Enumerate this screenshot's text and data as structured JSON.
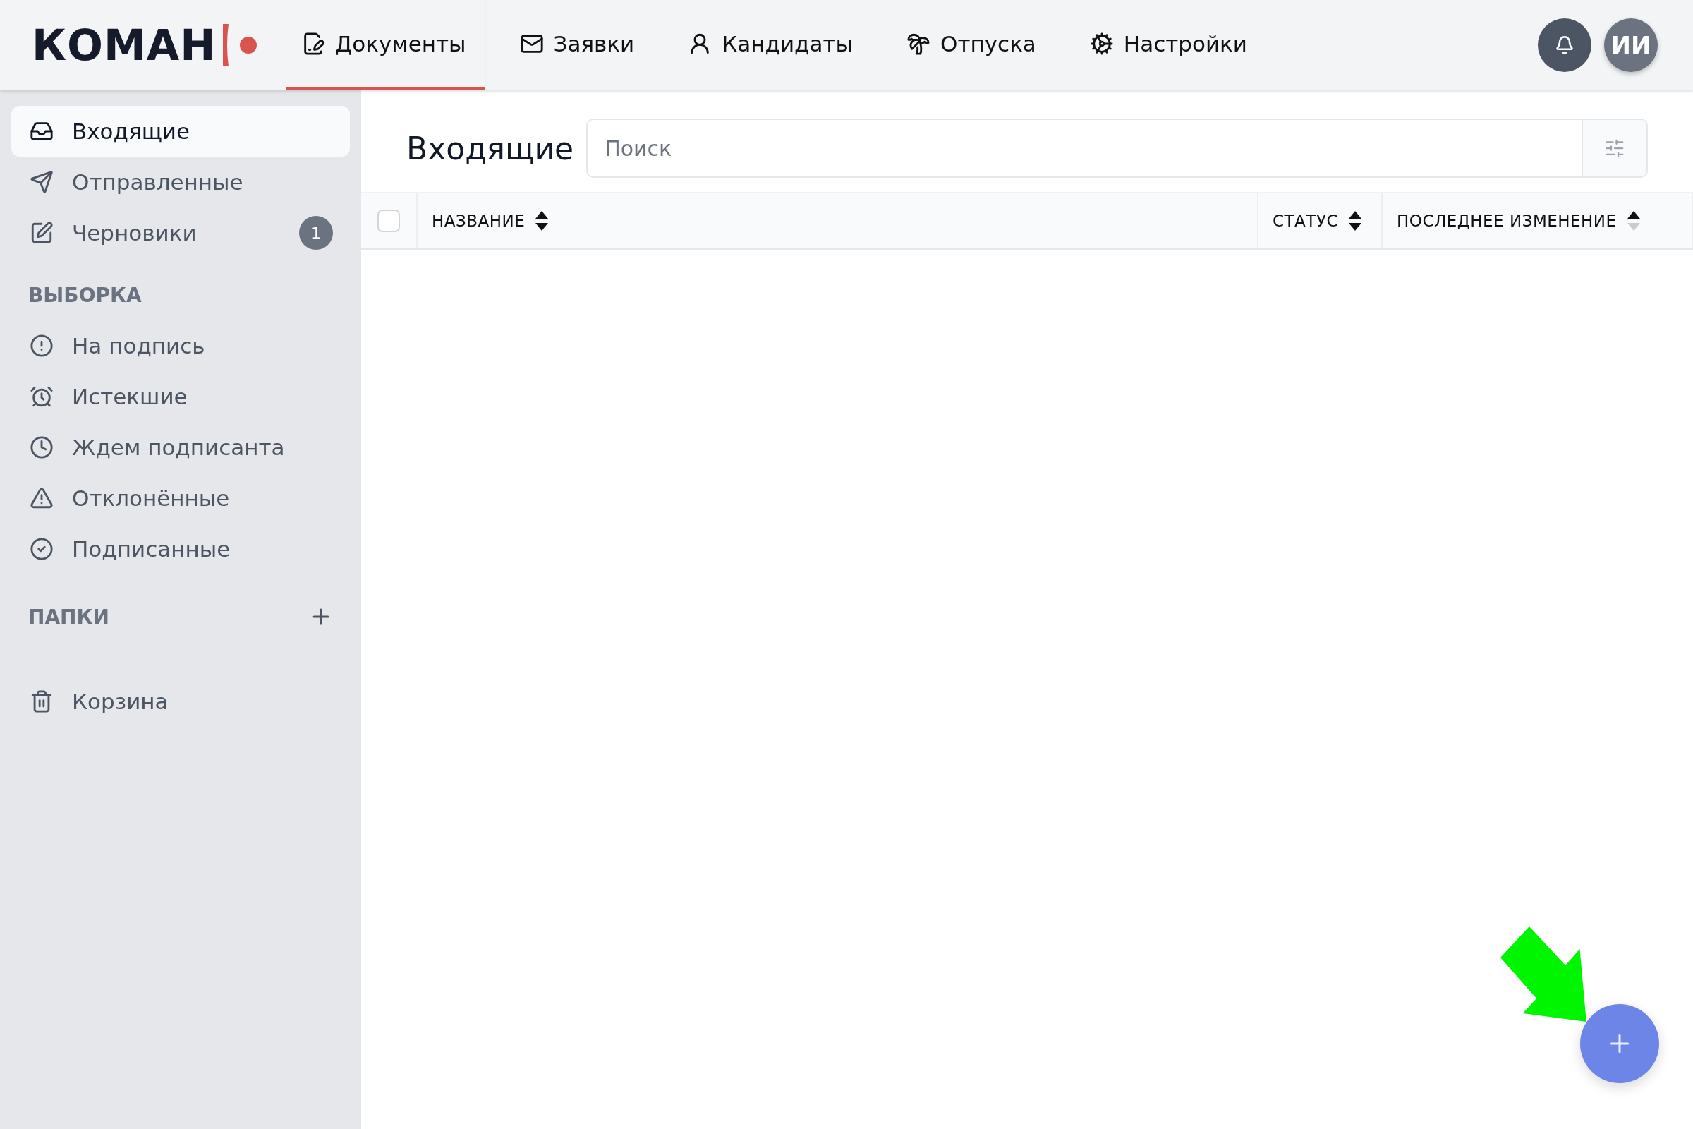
{
  "logo": {
    "text": "КОМАН"
  },
  "nav": [
    {
      "kind": "documents",
      "label": "Документы",
      "selected": true
    },
    {
      "kind": "requests",
      "label": "Заявки",
      "selected": false
    },
    {
      "kind": "candidates",
      "label": "Кандидаты",
      "selected": false
    },
    {
      "kind": "vacations",
      "label": "Отпуска",
      "selected": false
    },
    {
      "kind": "settings",
      "label": "Настройки",
      "selected": false
    }
  ],
  "user": {
    "initials": "ИИ"
  },
  "sidebar": {
    "mailboxes": [
      {
        "kind": "inbox",
        "label": "Входящие",
        "selected": true
      },
      {
        "kind": "sent",
        "label": "Отправленные",
        "selected": false
      },
      {
        "kind": "drafts",
        "label": "Черновики",
        "selected": false,
        "badge": "1"
      }
    ],
    "filter_heading": "ВЫБОРКА",
    "filters": [
      {
        "kind": "alert",
        "label": "На подпись",
        "selected": false
      },
      {
        "kind": "alarm",
        "label": "Истекшие",
        "selected": false
      },
      {
        "kind": "clock",
        "label": "Ждем подписанта",
        "selected": false
      },
      {
        "kind": "warning",
        "label": "Отклонённые",
        "selected": false
      },
      {
        "kind": "check",
        "label": "Подписанные",
        "selected": false
      }
    ],
    "folders_heading": "ПАПКИ",
    "trash": {
      "kind": "trash",
      "label": "Корзина",
      "selected": false
    }
  },
  "main": {
    "title": "Входящие",
    "search": {
      "placeholder": "Поиск"
    },
    "table": {
      "select_all_checked": false,
      "columns": [
        {
          "label": "НАЗВАНИЕ",
          "sorted_ascending": false
        },
        {
          "label": "СТАТУС",
          "sorted_ascending": false
        },
        {
          "label": "ПОСЛЕДНЕЕ ИЗМЕНЕНИЕ",
          "sorted_ascending": true
        }
      ]
    }
  }
}
